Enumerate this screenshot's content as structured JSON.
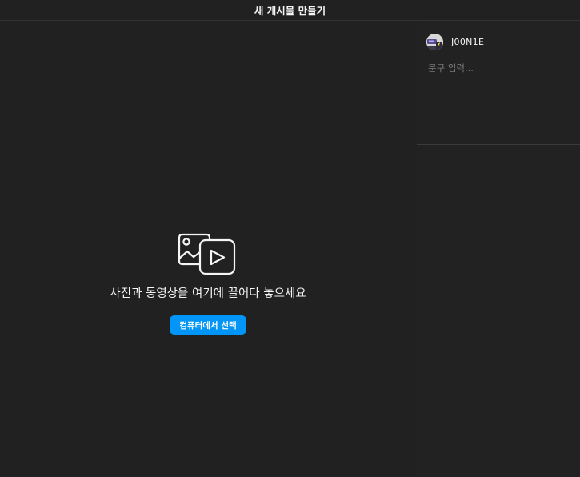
{
  "header": {
    "title": "새 게시물 만들기"
  },
  "upload": {
    "icon": "photo-video-icon",
    "prompt": "사진과 동영상을 여기에 끌어다 놓으세요",
    "button_label": "컴퓨터에서 선택"
  },
  "composer": {
    "username": "J00N1E",
    "avatar_icon": "avatar-image",
    "caption_value": "",
    "caption_placeholder": "문구 입력..."
  },
  "colors": {
    "background": "#212121",
    "accent": "#0095f6",
    "text": "#f5f5f5",
    "muted": "#7a7a7a",
    "divider": "#3a3a3a"
  }
}
